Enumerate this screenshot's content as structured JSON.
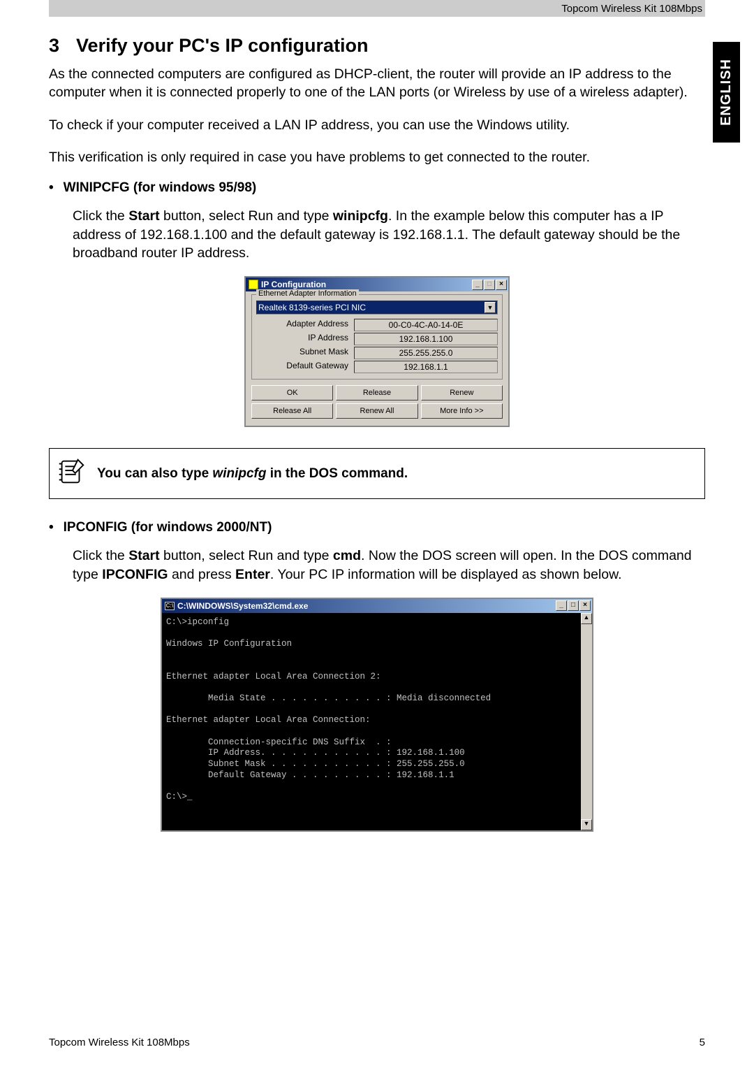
{
  "header": {
    "doc_title": "Topcom Wireless Kit 108Mbps"
  },
  "side_tab": "ENGLISH",
  "section": {
    "number": "3",
    "title": "Verify your PC's IP configuration",
    "intro1": "As the connected computers are configured as DHCP-client, the router will provide an IP address to the computer when it is connected properly to one of the LAN ports (or Wireless by use of a wireless adapter).",
    "intro2": "To check if your computer received a LAN IP address, you can use the Windows utility.",
    "intro3": "This verification is only required in case you have problems to get connected to the router."
  },
  "winipcfg_section": {
    "heading": "WINIPCFG (for windows 95/98)",
    "para_pre": "Click the ",
    "start": "Start",
    "para_mid1": " button, select Run and type ",
    "cmd": "winipcfg",
    "para_post": ". In the example below this computer has a IP address of 192.168.1.100 and the default gateway is 192.168.1.1. The default gateway should be the broadband router IP address."
  },
  "ipconfig_window": {
    "title": "IP Configuration",
    "legend": "Ethernet Adapter Information",
    "adapter": "Realtek 8139-series PCI NIC",
    "rows": {
      "adapter_addr_label": "Adapter Address",
      "adapter_addr_value": "00-C0-4C-A0-14-0E",
      "ip_label": "IP Address",
      "ip_value": "192.168.1.100",
      "subnet_label": "Subnet Mask",
      "subnet_value": "255.255.255.0",
      "gateway_label": "Default Gateway",
      "gateway_value": "192.168.1.1"
    },
    "buttons": {
      "ok": "OK",
      "release": "Release",
      "renew": "Renew",
      "release_all": "Release All",
      "renew_all": "Renew All",
      "more": "More Info >>"
    }
  },
  "note": {
    "pre": "You can also type ",
    "cmd": "winipcfg",
    "post": " in the DOS command."
  },
  "ipconfig_section": {
    "heading": "IPCONFIG (for windows 2000/NT)",
    "para_pre": "Click the ",
    "start": "Start",
    "mid1": " button, select Run and type ",
    "cmd": "cmd",
    "mid2": ". Now the DOS screen will open. In the DOS command type ",
    "ipconfig": "IPCONFIG",
    "mid3": " and press ",
    "enter": "Enter",
    "post": ". Your PC IP information will be displayed as shown below."
  },
  "cmd_window": {
    "title": "C:\\WINDOWS\\System32\\cmd.exe",
    "body": "C:\\>ipconfig\n\nWindows IP Configuration\n\n\nEthernet adapter Local Area Connection 2:\n\n        Media State . . . . . . . . . . . : Media disconnected\n\nEthernet adapter Local Area Connection:\n\n        Connection-specific DNS Suffix  . :\n        IP Address. . . . . . . . . . . . : 192.168.1.100\n        Subnet Mask . . . . . . . . . . . : 255.255.255.0\n        Default Gateway . . . . . . . . . : 192.168.1.1\n\nC:\\>_"
  },
  "footer": {
    "left": "Topcom Wireless Kit 108Mbps",
    "right": "5"
  }
}
